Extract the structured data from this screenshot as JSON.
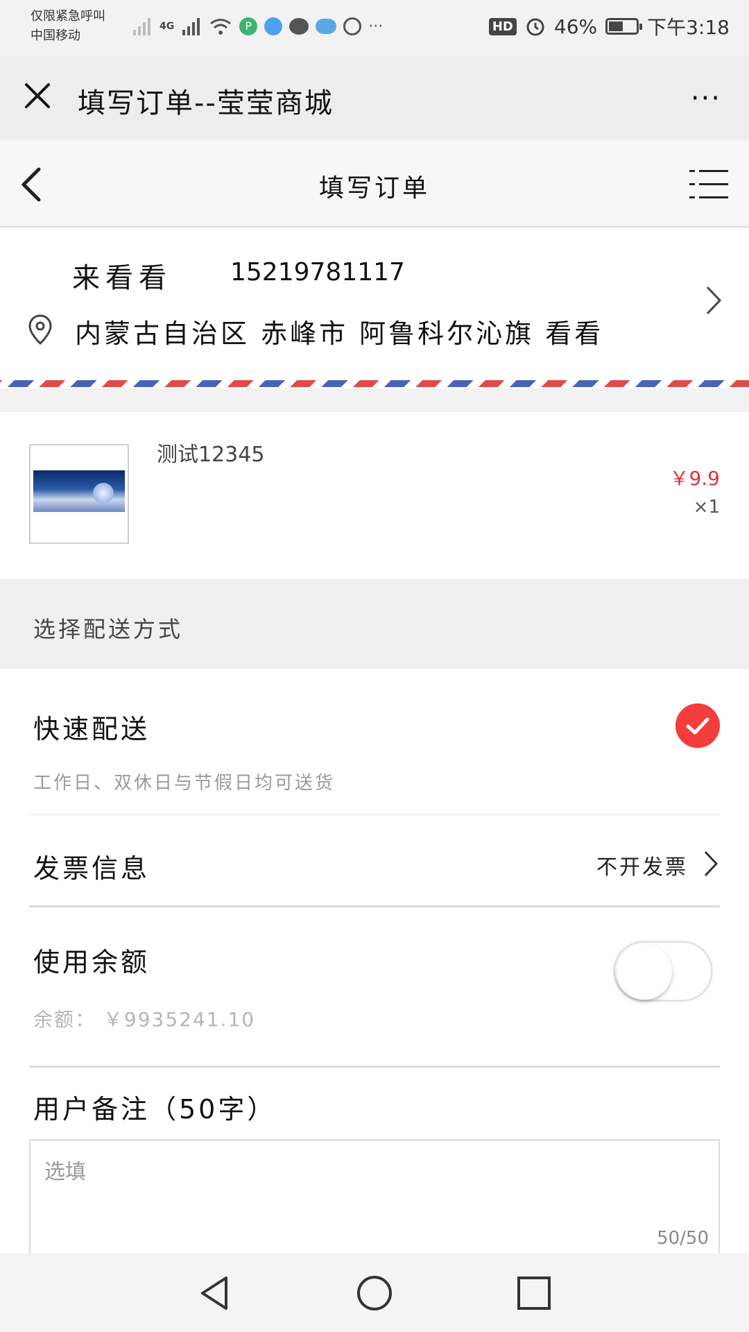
{
  "status_bar": {
    "carrier_line1": "仅限紧急呼叫",
    "carrier_line2": "中国移动",
    "network": "4G",
    "hd": "HD",
    "battery_text": "46%",
    "time": "下午3:18",
    "icons": [
      "signal-icon",
      "wifi-icon",
      "app-icon",
      "browser-icon",
      "chat-icon",
      "cloud-icon",
      "shield-icon",
      "alarm-icon",
      "battery-icon"
    ]
  },
  "titlebar": {
    "title": "填写订单--莹莹商城",
    "more": "···"
  },
  "header": {
    "title": "填写订单"
  },
  "address": {
    "name": "来看看",
    "phone": "15219781117",
    "detail": "内蒙古自治区 赤峰市 阿鲁科尔沁旗 看看"
  },
  "product": {
    "name": "测试12345",
    "price": "￥9.9",
    "quantity": "×1"
  },
  "delivery": {
    "section_label": "选择配送方式",
    "option_title": "快速配送",
    "option_desc": "工作日、双休日与节假日均可送货",
    "selected": true
  },
  "invoice": {
    "label": "发票信息",
    "value": "不开发票"
  },
  "balance": {
    "label": "使用余额",
    "amount_text": "余额：  ￥9935241.10",
    "toggle_on": false
  },
  "remark": {
    "title": "用户备注（50字）",
    "placeholder": "选填",
    "counter": "50/50"
  },
  "colors": {
    "accent": "#f53d3d",
    "price": "#e2313a",
    "stripe_red": "#e14a4a",
    "stripe_blue": "#4a63b7"
  }
}
